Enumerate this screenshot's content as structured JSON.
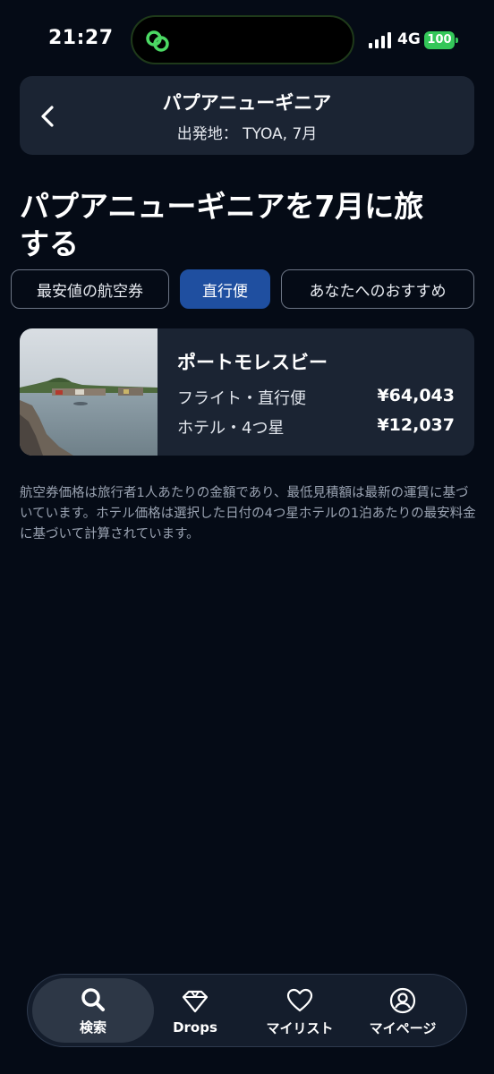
{
  "status": {
    "time": "21:27",
    "network": "4G",
    "battery": "100"
  },
  "header": {
    "title": "パプアニューギニア",
    "subtitle": "出発地： TYOA, 7月"
  },
  "page_title": "パプアニューギニアを7月に旅する",
  "tabs": [
    {
      "label": "最安値の航空券",
      "active": false
    },
    {
      "label": "直行便",
      "active": true
    },
    {
      "label": "あなたへのおすすめ",
      "active": false
    }
  ],
  "result": {
    "destination": "ポートモレスビー",
    "flight_label": "フライト・直行便",
    "flight_price": "¥64,043",
    "hotel_label": "ホテル・4つ星",
    "hotel_price": "¥12,037"
  },
  "note": "航空券価格は旅行者1人あたりの金額であり、最低見積額は最新の運賃に基づいています。ホテル価格は選択した日付の4つ星ホテルの1泊あたりの最安料金に基づいて計算されています。",
  "nav": {
    "search": "検索",
    "drops": "Drops",
    "mylist": "マイリスト",
    "mypage": "マイページ"
  },
  "colors": {
    "accent": "#1f4fa0",
    "card": "#1b2433",
    "background": "#050b16",
    "battery": "#34c759"
  }
}
